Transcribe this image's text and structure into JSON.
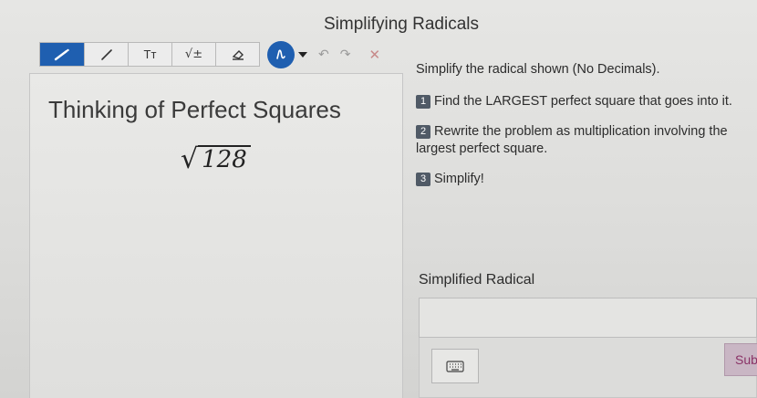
{
  "page": {
    "title": "Simplifying Radicals"
  },
  "toolbar": {
    "tools": [
      {
        "icon": "pen-icon"
      },
      {
        "icon": "line-icon"
      },
      {
        "icon": "text-tool-icon",
        "label": "Tт"
      },
      {
        "icon": "math-tool-icon",
        "label": "√±"
      },
      {
        "icon": "eraser-icon"
      }
    ],
    "active_color": "#1f5fb0"
  },
  "whiteboard": {
    "heading": "Thinking of Perfect Squares",
    "radicand": "128"
  },
  "instructions": {
    "intro": "Simplify the radical shown (No Decimals).",
    "steps": [
      {
        "number": "1",
        "text": "Find the LARGEST perfect square that goes into it."
      },
      {
        "number": "2",
        "text": "Rewrite the problem as multiplication involving the largest perfect square."
      },
      {
        "number": "3",
        "text": "Simplify!"
      }
    ]
  },
  "answer": {
    "label": "Simplified Radical",
    "value": "",
    "submit_label": "Submit"
  }
}
